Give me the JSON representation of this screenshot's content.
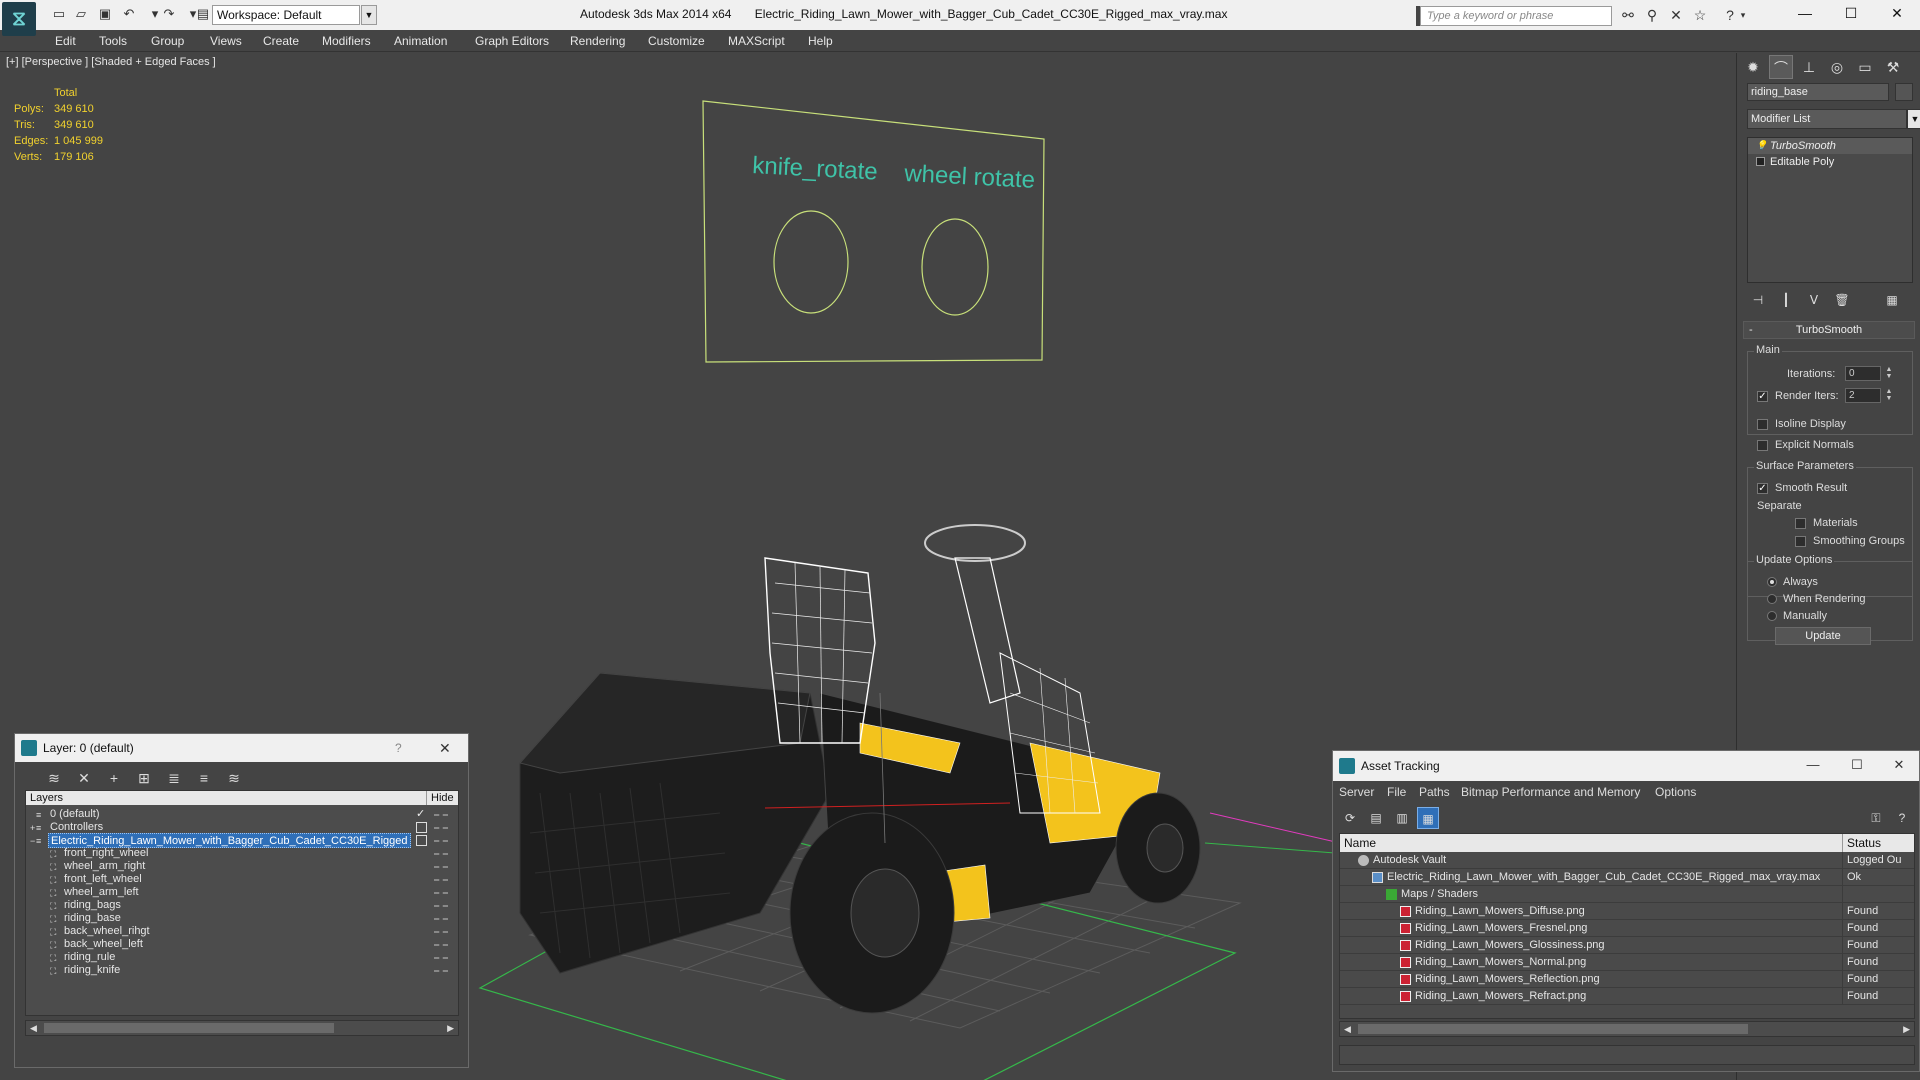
{
  "app": {
    "name": "Autodesk 3ds Max  2014 x64",
    "file": "Electric_Riding_Lawn_Mower_with_Bagger_Cub_Cadet_CC30E_Rigged_max_vray.max",
    "workspace": "Workspace: Default",
    "search_placeholder": "Type a keyword or phrase"
  },
  "menu": [
    "Edit",
    "Tools",
    "Group",
    "Views",
    "Create",
    "Modifiers",
    "Animation",
    "Graph Editors",
    "Rendering",
    "Customize",
    "MAXScript",
    "Help"
  ],
  "viewport": {
    "label": "[+] [Perspective ] [Shaded + Edged Faces ]",
    "stats": {
      "header": "Total",
      "rows": [
        {
          "k": "Polys:",
          "v": "349 610"
        },
        {
          "k": "Tris:",
          "v": "349 610"
        },
        {
          "k": "Edges:",
          "v": "1 045 999"
        },
        {
          "k": "Verts:",
          "v": "179 106"
        }
      ]
    },
    "control_panel": {
      "label_1": "knife_rotate",
      "label_2": "wheel rotate"
    }
  },
  "command_panel": {
    "object_name": "riding_base",
    "modifier_list": "Modifier List",
    "stack": [
      "TurboSmooth",
      "Editable Poly"
    ],
    "rollout": {
      "title": "TurboSmooth",
      "main_label": "Main",
      "iterations_label": "Iterations:",
      "iterations_value": "0",
      "render_iters_label": "Render Iters:",
      "render_iters_value": "2",
      "isoline": "Isoline Display",
      "explicit": "Explicit Normals",
      "surface_label": "Surface Parameters",
      "smooth_result": "Smooth Result",
      "separate_label": "Separate",
      "materials": "Materials",
      "smoothing_groups": "Smoothing Groups",
      "update_options_label": "Update Options",
      "always": "Always",
      "when_rendering": "When Rendering",
      "manually": "Manually",
      "update_button": "Update"
    }
  },
  "layer_window": {
    "title": "Layer: 0 (default)",
    "help": "?",
    "col_layers": "Layers",
    "col_hide": "Hide",
    "rows": [
      {
        "name": "0 (default)",
        "level": 0,
        "type": "layer"
      },
      {
        "name": "Controllers",
        "level": 0,
        "type": "layer"
      },
      {
        "name": "Electric_Riding_Lawn_Mower_with_Bagger_Cub_Cadet_CC30E_Rigged",
        "level": 0,
        "type": "layer"
      },
      {
        "name": "front_right_wheel",
        "level": 1,
        "type": "object"
      },
      {
        "name": "wheel_arm_right",
        "level": 1,
        "type": "object"
      },
      {
        "name": "front_left_wheel",
        "level": 1,
        "type": "object"
      },
      {
        "name": "wheel_arm_left",
        "level": 1,
        "type": "object"
      },
      {
        "name": "riding_bags",
        "level": 1,
        "type": "object"
      },
      {
        "name": "riding_base",
        "level": 1,
        "type": "object"
      },
      {
        "name": "back_wheel_rihgt",
        "level": 1,
        "type": "object"
      },
      {
        "name": "back_wheel_left",
        "level": 1,
        "type": "object"
      },
      {
        "name": "riding_rule",
        "level": 1,
        "type": "object"
      },
      {
        "name": "riding_knife",
        "level": 1,
        "type": "object"
      }
    ]
  },
  "asset_window": {
    "title": "Asset Tracking",
    "menu": [
      "Server",
      "File",
      "Paths",
      "Bitmap Performance and Memory",
      "Options"
    ],
    "col_name": "Name",
    "col_status": "Status",
    "rows": [
      {
        "name": "Autodesk Vault",
        "status": "Logged Ou",
        "level": 0,
        "icon": "vault"
      },
      {
        "name": "Electric_Riding_Lawn_Mower_with_Bagger_Cub_Cadet_CC30E_Rigged_max_vray.max",
        "status": "Ok",
        "level": 1,
        "icon": "file"
      },
      {
        "name": "Maps / Shaders",
        "status": "",
        "level": 2,
        "icon": "folder"
      },
      {
        "name": "Riding_Lawn_Mowers_Diffuse.png",
        "status": "Found",
        "level": 3,
        "icon": "png"
      },
      {
        "name": "Riding_Lawn_Mowers_Fresnel.png",
        "status": "Found",
        "level": 3,
        "icon": "png"
      },
      {
        "name": "Riding_Lawn_Mowers_Glossiness.png",
        "status": "Found",
        "level": 3,
        "icon": "png"
      },
      {
        "name": "Riding_Lawn_Mowers_Normal.png",
        "status": "Found",
        "level": 3,
        "icon": "png"
      },
      {
        "name": "Riding_Lawn_Mowers_Reflection.png",
        "status": "Found",
        "level": 3,
        "icon": "png"
      },
      {
        "name": "Riding_Lawn_Mowers_Refract.png",
        "status": "Found",
        "level": 3,
        "icon": "png"
      }
    ]
  },
  "colors": {
    "stats": "#f1d12e",
    "selection": "#2f6fb8",
    "controller_frame": "#c8e07a",
    "controller_text": "#3fc3a8",
    "mower_yellow": "#f3c31c"
  }
}
